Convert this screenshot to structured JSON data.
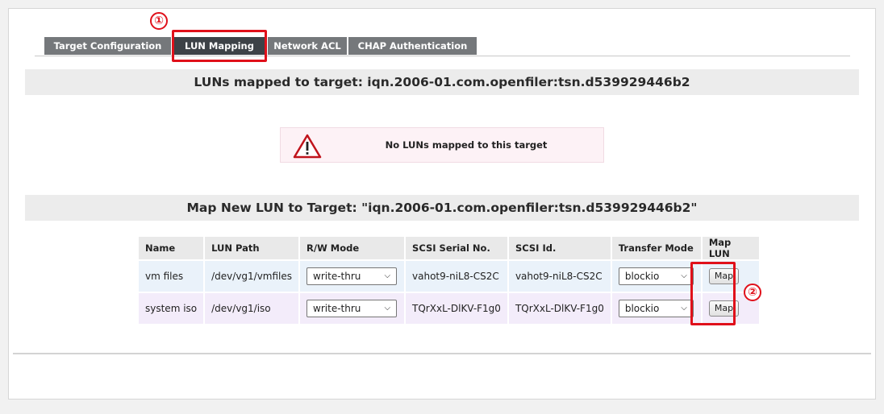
{
  "tabs": [
    {
      "label": "Target Configuration",
      "active": false
    },
    {
      "label": "LUN Mapping",
      "active": true
    },
    {
      "label": "Network ACL",
      "active": false
    },
    {
      "label": "CHAP Authentication",
      "active": false
    }
  ],
  "annotations": {
    "marker_1": "①",
    "marker_2": "②",
    "highlight_color": "#e0101a"
  },
  "mapped_section": {
    "title": "LUNs mapped to target: iqn.2006-01.com.openfiler:tsn.d539929446b2"
  },
  "alert": {
    "icon": "warning-triangle-icon",
    "message": "No LUNs mapped to this target"
  },
  "map_section": {
    "title": "Map New LUN to Target: \"iqn.2006-01.com.openfiler:tsn.d539929446b2\""
  },
  "table": {
    "headers": [
      "Name",
      "LUN Path",
      "R/W Mode",
      "SCSI Serial No.",
      "SCSI Id.",
      "Transfer Mode",
      "Map LUN"
    ],
    "rows": [
      {
        "name": "vm files",
        "path": "/dev/vg1/vmfiles",
        "rw_mode": "write-thru",
        "serial": "vahot9-niL8-CS2C",
        "scsi_id": "vahot9-niL8-CS2C",
        "transfer_mode": "blockio",
        "action": "Map"
      },
      {
        "name": "system iso",
        "path": "/dev/vg1/iso",
        "rw_mode": "write-thru",
        "serial": "TQrXxL-DlKV-F1g0",
        "scsi_id": "TQrXxL-DlKV-F1g0",
        "transfer_mode": "blockio",
        "action": "Map"
      }
    ]
  }
}
